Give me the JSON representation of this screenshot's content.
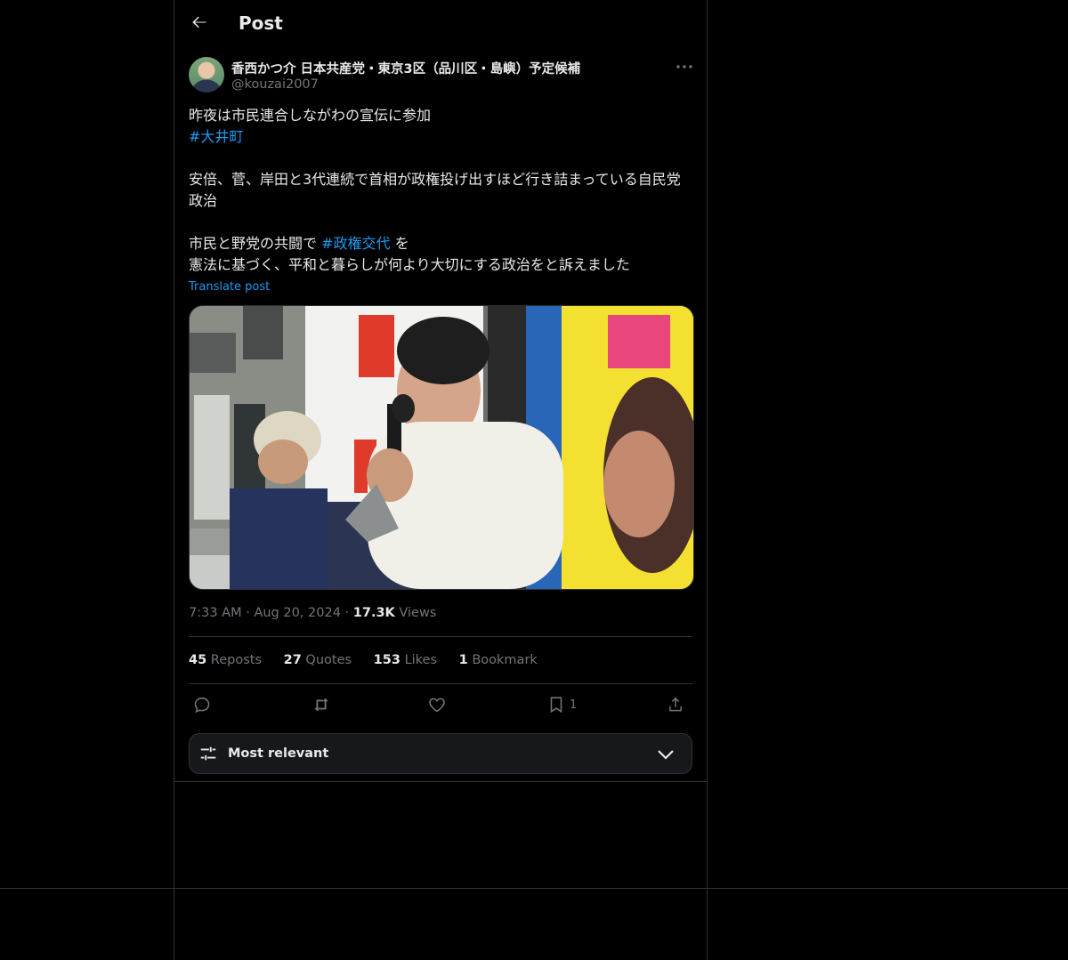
{
  "header": {
    "title": "Post",
    "back_icon": "arrow-left-icon"
  },
  "author": {
    "display_name": "香西かつ介 日本共産党・東京3区（品川区・島嶼）予定候補",
    "handle": "@kouzai2007"
  },
  "post": {
    "line1": "昨夜は市民連合しながわの宣伝に参加",
    "hashtag1": "#大井町",
    "line2": "安倍、菅、岸田と3代連続で首相が政権投げ出すほど行き詰まっている自民党政治",
    "line3_pre": "市民と野党の共闘で",
    "hashtag2": "#政権交代",
    "line3_post": "を",
    "line4": "憲法に基づく、平和と暮らしが何より大切にする政治をと訴えました",
    "translate": "Translate post"
  },
  "meta": {
    "time": "7:33 AM",
    "date": "Aug 20, 2024",
    "views_count": "17.3K",
    "views_label": "Views"
  },
  "stats": {
    "reposts_count": "45",
    "reposts_label": "Reposts",
    "quotes_count": "27",
    "quotes_label": "Quotes",
    "likes_count": "153",
    "likes_label": "Likes",
    "bookmarks_count": "1",
    "bookmarks_label": "Bookmark"
  },
  "actions": {
    "bookmark_count": "1"
  },
  "sort": {
    "label": "Most relevant"
  },
  "colors": {
    "background": "#000000",
    "text": "#e7e9ea",
    "muted": "#71767b",
    "accent": "#1d9bf0",
    "border": "#2f3336"
  }
}
